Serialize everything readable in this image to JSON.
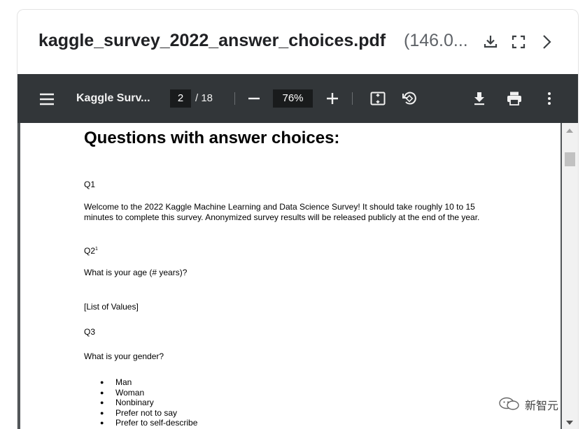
{
  "file": {
    "title": "kaggle_survey_2022_answer_choices.pdf",
    "size": "(146.0..."
  },
  "header_icons": [
    "download-icon",
    "fullscreen-icon",
    "chevron-right-icon"
  ],
  "toolbar": {
    "doc_title": "Kaggle Surv...",
    "page_current": "2",
    "page_total": "/ 18",
    "zoom": "76%",
    "icons": [
      "menu-icon",
      "zoom-out-icon",
      "zoom-in-icon",
      "fit-page-icon",
      "rotate-icon",
      "download-icon",
      "print-icon",
      "more-vert-icon"
    ]
  },
  "page": {
    "heading": "Questions with answer choices:",
    "q1": "Q1",
    "welcome": "Welcome to the 2022 Kaggle Machine Learning and Data Science Survey! It should take roughly 10 to 15 minutes to complete this survey. Anonymized survey results will be released publicly at the end of the year.",
    "q2": "Q2",
    "q2_footnote": "1",
    "q2_text": "What is your age (# years)?",
    "q2_values": "[List of Values]",
    "q3": "Q3",
    "q3_text": "What is your gender?",
    "q3_options": [
      "Man",
      "Woman",
      "Nonbinary",
      "Prefer not to say",
      "Prefer to self-describe"
    ]
  },
  "watermark": {
    "text": "新智元"
  },
  "colors": {
    "toolbar": "#323639",
    "viewer_bg": "#525659",
    "input_bg": "#191b1c"
  }
}
